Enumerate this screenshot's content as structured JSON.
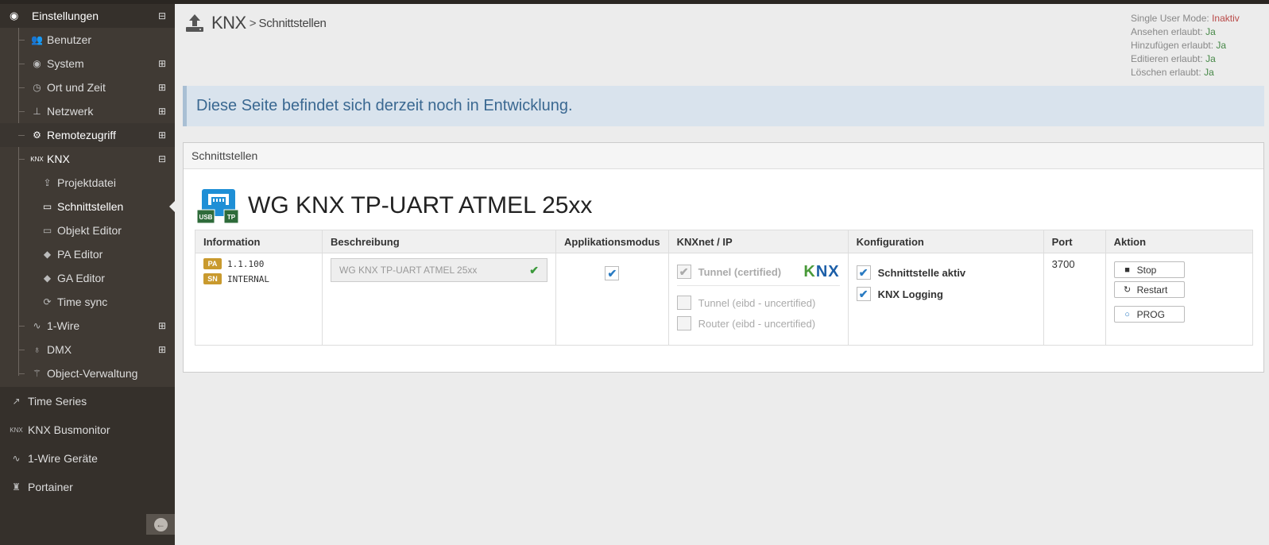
{
  "sidebar": {
    "header": {
      "label": "Einstellungen",
      "icon": "dashboard-icon",
      "toggle": "⊟"
    },
    "items": [
      {
        "label": "Benutzer",
        "icon": "users-icon"
      },
      {
        "label": "System",
        "icon": "dashboard-icon",
        "toggle": "⊞"
      },
      {
        "label": "Ort und Zeit",
        "icon": "clock-icon",
        "toggle": "⊞"
      },
      {
        "label": "Netzwerk",
        "icon": "sitemap-icon",
        "toggle": "⊞"
      },
      {
        "label": "Remotezugriff",
        "icon": "cogs-icon",
        "toggle": "⊞"
      },
      {
        "label": "KNX",
        "icon": "knx-icon",
        "toggle": "⊟"
      },
      {
        "label": "Projektdatei",
        "icon": "upload-icon"
      },
      {
        "label": "Schnittstellen",
        "icon": "laptop-icon"
      },
      {
        "label": "Objekt Editor",
        "icon": "laptop-icon"
      },
      {
        "label": "PA Editor",
        "icon": "tag-icon"
      },
      {
        "label": "GA Editor",
        "icon": "tag-icon"
      },
      {
        "label": "Time sync",
        "icon": "refresh-icon"
      },
      {
        "label": "1-Wire",
        "icon": "pulse-icon",
        "toggle": "⊞"
      },
      {
        "label": "DMX",
        "icon": "lightbulb-icon",
        "toggle": "⊞"
      },
      {
        "label": "Object-Verwaltung",
        "icon": "magic-icon"
      }
    ],
    "main": [
      {
        "label": "Time Series",
        "icon": "line-chart-icon"
      },
      {
        "label": "KNX Busmonitor",
        "icon": "knx-icon"
      },
      {
        "label": "1-Wire Geräte",
        "icon": "pulse-icon"
      },
      {
        "label": "Portainer",
        "icon": "fire-extinguisher-icon"
      }
    ]
  },
  "header": {
    "title": "KNX",
    "separator": ">",
    "subtitle": "Schnittstellen"
  },
  "permissions": {
    "single_user_label": "Single User Mode:",
    "single_user_value": "Inaktiv",
    "view_label": "Ansehen erlaubt:",
    "view_value": "Ja",
    "add_label": "Hinzufügen erlaubt:",
    "add_value": "Ja",
    "edit_label": "Editieren erlaubt:",
    "edit_value": "Ja",
    "delete_label": "Löschen erlaubt:",
    "delete_value": "Ja"
  },
  "alert": "Diese Seite befindet sich derzeit noch in Entwicklung.",
  "panel": {
    "title": "Schnittstellen",
    "device_name": "WG KNX TP-UART ATMEL 25xx",
    "device_icon_labels": {
      "usb": "USB",
      "tp": "TP"
    },
    "columns": [
      "Information",
      "Beschreibung",
      "Applikationsmodus",
      "KNXnet / IP",
      "Konfiguration",
      "Port",
      "Aktion"
    ],
    "row": {
      "pa_badge": "PA",
      "pa_value": "1.1.100",
      "sn_badge": "SN",
      "sn_value": "INTERNAL",
      "description": "WG KNX TP-UART ATMEL 25xx",
      "app_mode_checked": true,
      "knxnet": {
        "tunnel_certified": "Tunnel (certified)",
        "tunnel_certified_checked": true,
        "tunnel_eibd": "Tunnel (eibd - uncertified)",
        "router_eibd": "Router (eibd - uncertified)",
        "logo_k": "K",
        "logo_nx": "NX"
      },
      "config": {
        "active_label": "Schnittstelle aktiv",
        "active_checked": true,
        "logging_label": "KNX Logging",
        "logging_checked": true
      },
      "port": "3700",
      "actions": {
        "stop": "Stop",
        "restart": "Restart",
        "prog": "PROG"
      }
    }
  }
}
